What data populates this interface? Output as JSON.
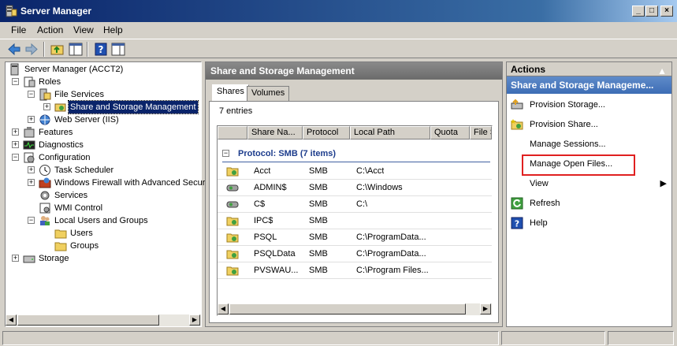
{
  "window": {
    "title": "Server Manager"
  },
  "menu": {
    "file": "File",
    "action": "Action",
    "view": "View",
    "help": "Help"
  },
  "tree": {
    "items": [
      {
        "label": "Server Manager (ACCT2)"
      },
      {
        "label": "Roles"
      },
      {
        "label": "File Services"
      },
      {
        "label": "Share and Storage Management"
      },
      {
        "label": "Web Server (IIS)"
      },
      {
        "label": "Features"
      },
      {
        "label": "Diagnostics"
      },
      {
        "label": "Configuration"
      },
      {
        "label": "Task Scheduler"
      },
      {
        "label": "Windows Firewall with Advanced Secur"
      },
      {
        "label": "Services"
      },
      {
        "label": "WMI Control"
      },
      {
        "label": "Local Users and Groups"
      },
      {
        "label": "Users"
      },
      {
        "label": "Groups"
      },
      {
        "label": "Storage"
      }
    ]
  },
  "center": {
    "header": "Share and Storage Management",
    "tabs": [
      "Shares",
      "Volumes"
    ],
    "entries": "7 entries",
    "columns": [
      "Share Na...",
      "Protocol",
      "Local Path",
      "Quota",
      "File S"
    ],
    "group": "Protocol: SMB (7 items)",
    "rows": [
      {
        "name": "Acct",
        "protocol": "SMB",
        "path": "C:\\Acct"
      },
      {
        "name": "ADMIN$",
        "protocol": "SMB",
        "path": "C:\\Windows"
      },
      {
        "name": "C$",
        "protocol": "SMB",
        "path": "C:\\"
      },
      {
        "name": "IPC$",
        "protocol": "SMB",
        "path": ""
      },
      {
        "name": "PSQL",
        "protocol": "SMB",
        "path": "C:\\ProgramData..."
      },
      {
        "name": "PSQLData",
        "protocol": "SMB",
        "path": "C:\\ProgramData..."
      },
      {
        "name": "PVSWAU...",
        "protocol": "SMB",
        "path": "C:\\Program Files..."
      }
    ]
  },
  "actions": {
    "title": "Actions",
    "section": "Share and Storage Manageme...",
    "items": [
      {
        "label": "Provision Storage..."
      },
      {
        "label": "Provision Share..."
      },
      {
        "label": "Manage Sessions..."
      },
      {
        "label": "Manage Open Files..."
      },
      {
        "label": "View"
      },
      {
        "label": "Refresh"
      },
      {
        "label": "Help"
      }
    ],
    "highlight_color": "#e02020"
  }
}
